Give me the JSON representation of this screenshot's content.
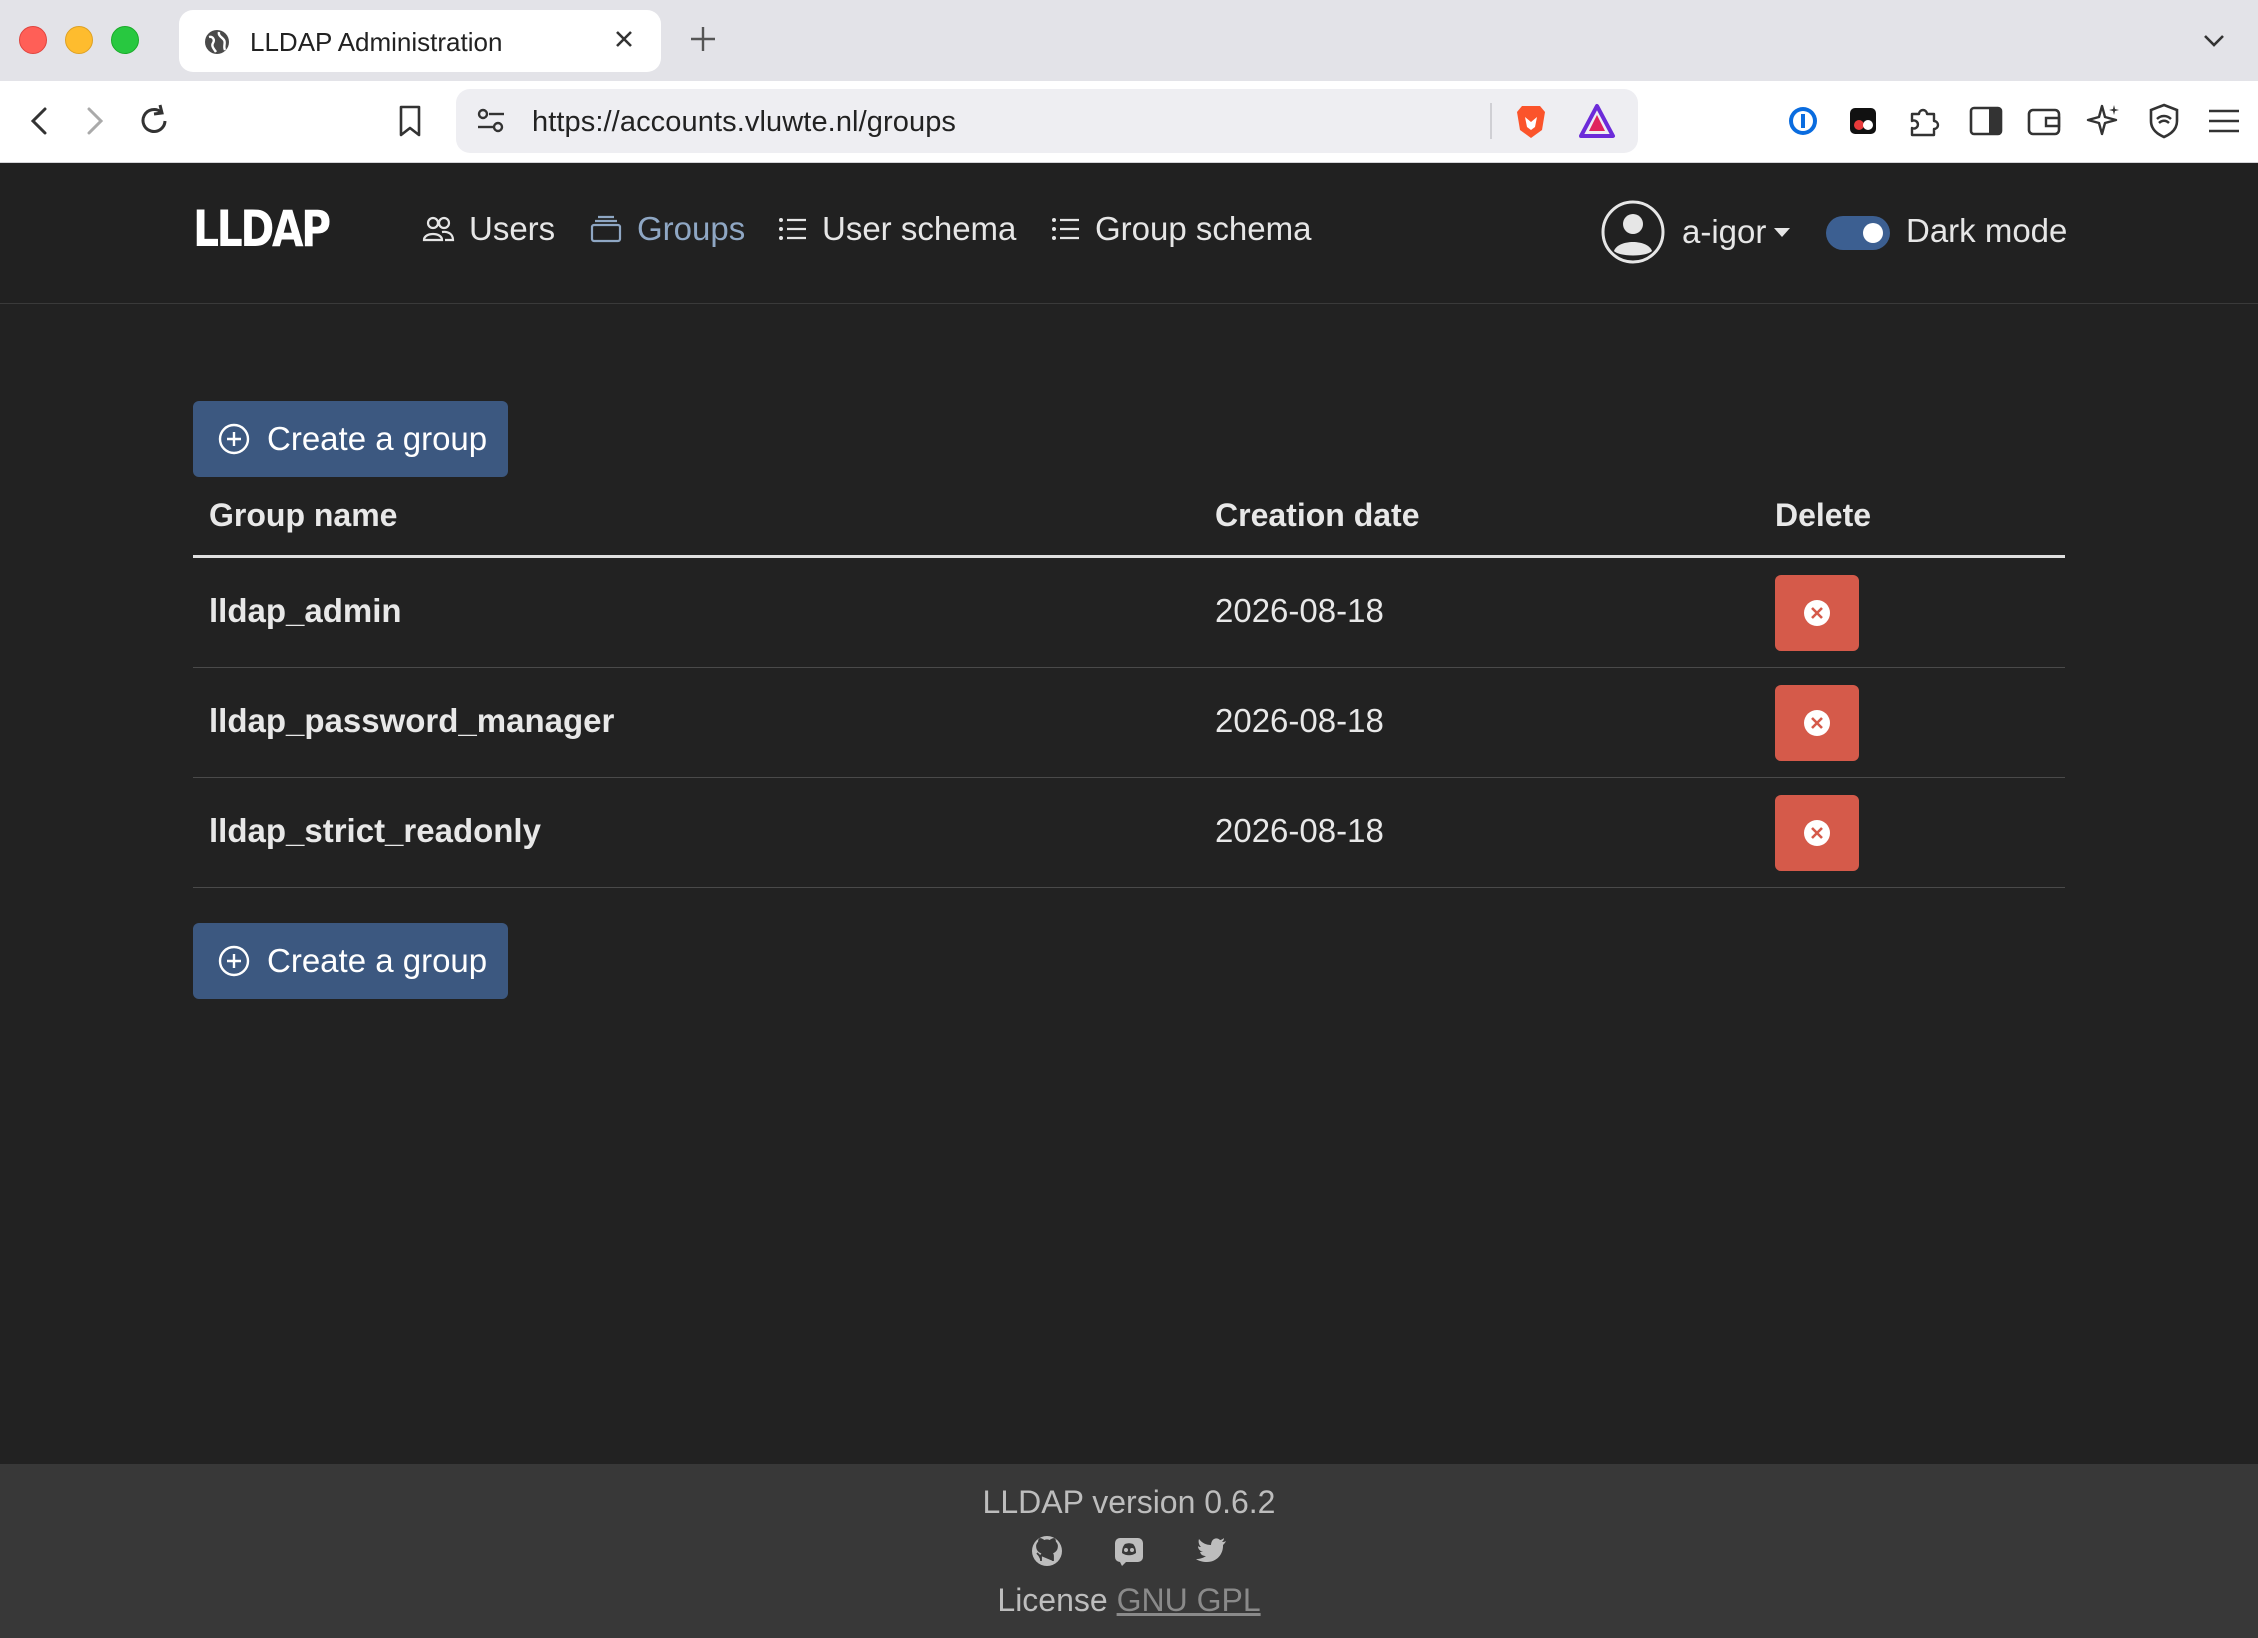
{
  "browser": {
    "tab_title": "LLDAP Administration",
    "url": "https://accounts.vluwte.nl/groups"
  },
  "navbar": {
    "brand": "LLDAP",
    "items": [
      {
        "label": "Users",
        "icon": "users-icon",
        "active": false
      },
      {
        "label": "Groups",
        "icon": "groups-icon",
        "active": true
      },
      {
        "label": "User schema",
        "icon": "list-icon",
        "active": false
      },
      {
        "label": "Group schema",
        "icon": "list-icon",
        "active": false
      }
    ],
    "username": "a-igor",
    "dark_mode_label": "Dark mode",
    "dark_mode_on": true
  },
  "main": {
    "create_button_label": "Create a group",
    "table": {
      "columns": [
        "Group name",
        "Creation date",
        "Delete"
      ],
      "rows": [
        {
          "name": "lldap_admin",
          "created": "2026-08-18"
        },
        {
          "name": "lldap_password_manager",
          "created": "2026-08-18"
        },
        {
          "name": "lldap_strict_readonly",
          "created": "2026-08-18"
        }
      ]
    }
  },
  "footer": {
    "version": "LLDAP version 0.6.2",
    "license_prefix": "License",
    "license_link": "GNU GPL",
    "social_icons": [
      "github-icon",
      "discord-icon",
      "twitter-icon"
    ]
  },
  "colors": {
    "page_bg": "#222222",
    "primary_button": "#3c5880",
    "danger_button": "#d55a4a",
    "active_nav": "#8fa7c4"
  }
}
